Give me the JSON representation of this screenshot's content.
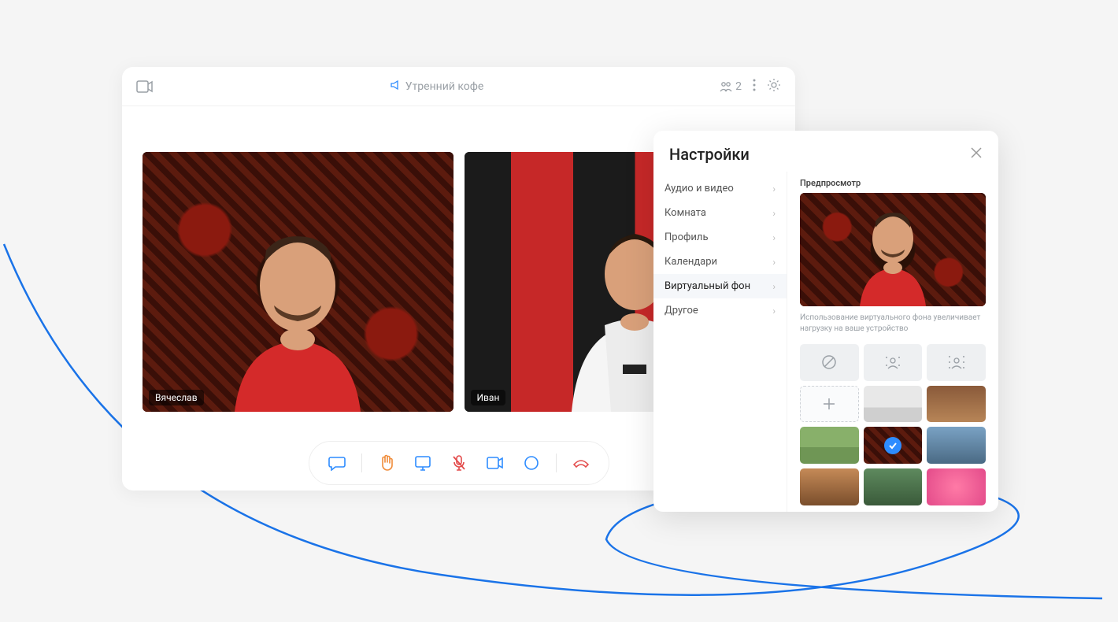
{
  "header": {
    "title": "Утренний кофе",
    "participants_count": "2"
  },
  "videos": {
    "tile1_name": "Вячеслав",
    "tile2_name": "Иван"
  },
  "toolbar": {
    "chat": "chat",
    "raise_hand": "raise-hand",
    "share_screen": "share-screen",
    "mic": "mic-muted",
    "camera": "camera",
    "record": "record",
    "leave": "leave"
  },
  "settings": {
    "title": "Настройки",
    "nav": {
      "audio_video": "Аудио и видео",
      "room": "Комната",
      "profile": "Профиль",
      "calendars": "Календари",
      "virtual_bg": "Виртуальный фон",
      "other": "Другое"
    },
    "preview_label": "Предпросмотр",
    "hint": "Использование виртуального фона увеличивает нагрузку на ваше устройство",
    "bg_options": {
      "none": "none",
      "blur_light": "blur-light",
      "blur_strong": "blur-strong",
      "add": "add-custom",
      "selected": "carpet"
    }
  }
}
